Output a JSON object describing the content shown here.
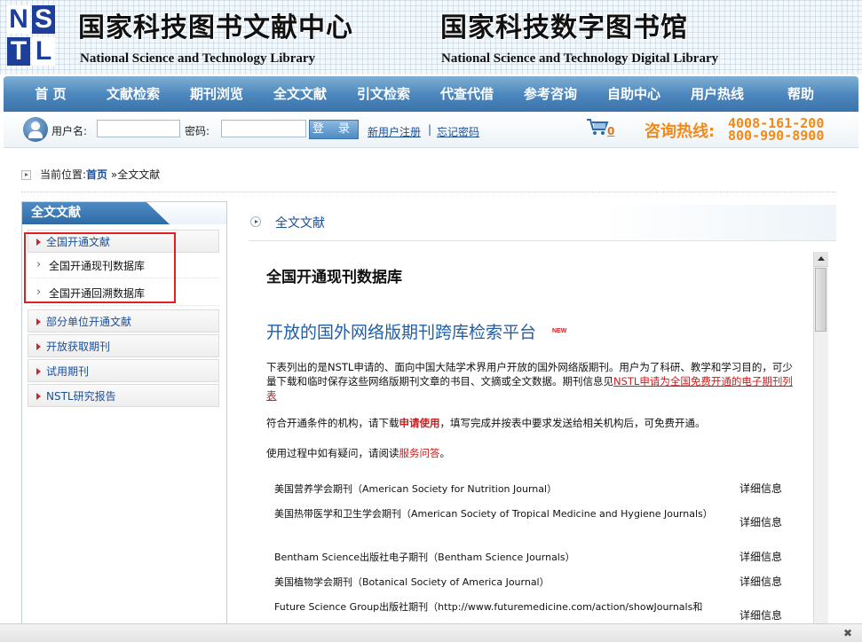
{
  "header": {
    "logo_letters": [
      "N",
      "S",
      "T",
      "L"
    ],
    "site_cn_1": "国家科技图书文献中心",
    "site_cn_2": "国家科技数字图书馆",
    "site_en_1": "National Science and Technology Library",
    "site_en_2": "National Science and Technology Digital Library"
  },
  "nav": {
    "items": [
      "首 页",
      "文献检索",
      "期刊浏览",
      "全文文献",
      "引文检索",
      "代查代借",
      "参考咨询",
      "自助中心",
      "用户热线",
      "帮助"
    ]
  },
  "login": {
    "username_label": "用户名:",
    "username_value": "",
    "password_label": "密码:",
    "password_value": "",
    "login_button": "登 录",
    "register_link": "新用户注册",
    "separator": "|",
    "forgot_link": "忘记密码",
    "cart_count": "0",
    "hotline_label": "咨询热线:",
    "hotline_1": "4008-161-200",
    "hotline_2": "800-990-8900"
  },
  "breadcrumb": {
    "prefix": "当前位置:",
    "home": "首页",
    "divider": "»",
    "current": "全文文献"
  },
  "sidebar": {
    "title": "全文文献",
    "items": [
      {
        "label": "全国开通文献"
      },
      {
        "label": "全国开通现刊数据库"
      },
      {
        "label": "全国开通回溯数据库"
      },
      {
        "label": "部分单位开通文献"
      },
      {
        "label": "开放获取期刊"
      },
      {
        "label": "试用期刊"
      },
      {
        "label": "NSTL研究报告"
      }
    ]
  },
  "main": {
    "tab_label": "全文文献",
    "db_title": "全国开通现刊数据库",
    "platform_title": "开放的国外网络版期刊跨库检索平台",
    "new_badge": "NEW",
    "intro_text": "下表列出的是NSTL申请的、面向中国大陆学术界用户开放的国外网络版期刊。用户为了科研、教学和学习目的，可少量下载和临时保存这些网络版期刊文章的书目、文摘或全文数据。期刊信息见",
    "intro_link": "NSTL申请为全国免费开通的电子期刊列表",
    "apply_text_1": "符合开通条件的机构，请下载",
    "apply_link": "申请使用",
    "apply_text_2": "，填写完成并按表中要求发送给相关机构后，可免费开通。",
    "faq_text_1": "使用过程中如有疑问，请阅读",
    "faq_link": "服务问答",
    "faq_text_2": "。",
    "detail_label": "详细信息",
    "journals": [
      {
        "name": "美国营养学会期刊（American Society for Nutrition Journal）"
      },
      {
        "name": "美国热带医学和卫生学会期刊（American Society of Tropical Medicine and Hygiene Journals）"
      },
      {
        "name": "Bentham Science出版社电子期刊（Bentham Science Journals）"
      },
      {
        "name": "美国植物学会期刊（Botanical Society of America Journal）"
      },
      {
        "name": "Future Science Group出版社期刊（http://www.futuremedicine.com/action/showJournals和"
      }
    ]
  }
}
